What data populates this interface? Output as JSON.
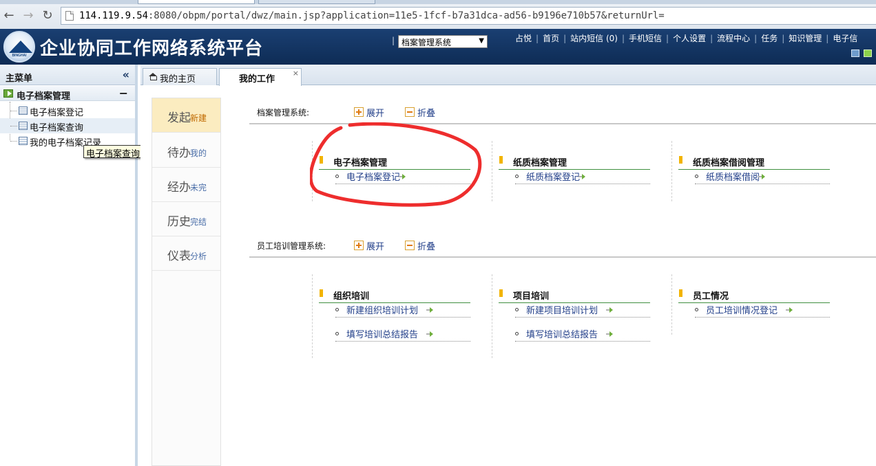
{
  "browser": {
    "url_host": "114.119.9.54",
    "url_rest": ":8080/obpm/portal/dwz/main.jsp?application=11e5-1fcf-b7a31dca-ad56-b9196e710b57&returnUrl=",
    "back_icon": "back-arrow-icon",
    "forward_icon": "forward-arrow-icon",
    "reload_icon": "reload-icon"
  },
  "header": {
    "title": "企业协同工作网络系统平台",
    "logo_text": "BINGHAI",
    "system_select": "档案管理系统",
    "links": [
      "占悦",
      "首页",
      "站内短信 (0)",
      "手机短信",
      "个人设置",
      "流程中心",
      "任务",
      "知识管理",
      "电子信"
    ]
  },
  "sidebar": {
    "title": "主菜单",
    "group": "电子档案管理",
    "items": [
      "电子档案登记",
      "电子档案查询",
      "我的电子档案记录"
    ],
    "tooltip": "电子档案查询"
  },
  "tabs": [
    {
      "label": "我的主页"
    },
    {
      "label": "我的工作"
    }
  ],
  "left_nav": [
    {
      "big": "发起",
      "small": "新建"
    },
    {
      "big": "待办",
      "small": "我的"
    },
    {
      "big": "经办",
      "small": "未完"
    },
    {
      "big": "历史",
      "small": "完结"
    },
    {
      "big": "仪表",
      "small": "分析"
    }
  ],
  "sections": [
    {
      "title": "档案管理系统:",
      "expand": "展开",
      "collapse": "折叠",
      "columns": [
        {
          "title": "电子档案管理",
          "items": [
            "电子档案登记"
          ]
        },
        {
          "title": "纸质档案管理",
          "items": [
            "纸质档案登记"
          ]
        },
        {
          "title": "纸质档案借阅管理",
          "items": [
            "纸质档案借阅"
          ]
        }
      ]
    },
    {
      "title": "员工培训管理系统:",
      "expand": "展开",
      "collapse": "折叠",
      "columns": [
        {
          "title": "组织培训",
          "items": [
            "新建组织培训计划",
            "填写培训总结报告"
          ]
        },
        {
          "title": "项目培训",
          "items": [
            "新建项目培训计划",
            "填写培训总结报告"
          ]
        },
        {
          "title": "员工情况",
          "items": [
            "员工培训情况登记"
          ]
        }
      ]
    }
  ],
  "colors": {
    "header_bg": "#0e2c55",
    "annotation": "#ee2d2d",
    "active_nav": "#fbecc0",
    "column_rule": "#3f8f3f",
    "marker": "#f2b400"
  }
}
